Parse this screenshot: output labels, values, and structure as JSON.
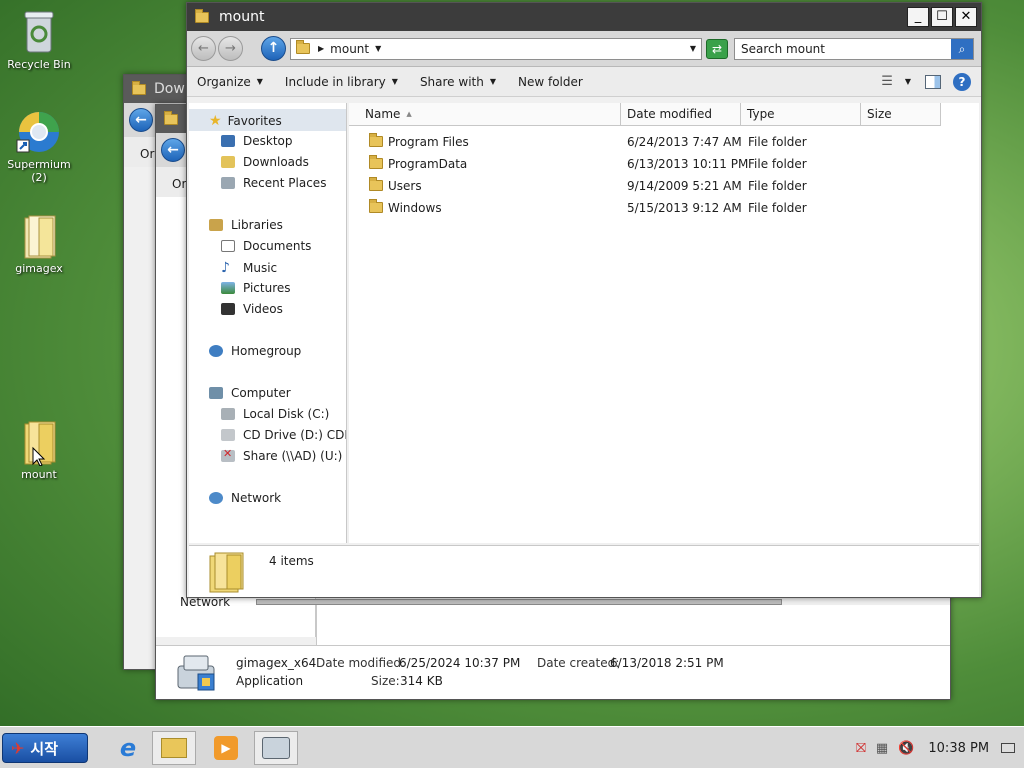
{
  "desktop": {
    "icons": [
      {
        "label": "Recycle Bin"
      },
      {
        "label": "Supermium\n(2)"
      },
      {
        "label": "gimagex"
      },
      {
        "label": "mount"
      }
    ]
  },
  "bg_window_1": {
    "title": "Dow",
    "nav_frag": "Or"
  },
  "bg_window_2": {
    "title": "gimagex_x64",
    "nav_frag": "Or",
    "nav_network": "Network",
    "details": {
      "name": "gimagex_x64",
      "type": "Application",
      "date_modified_label": "Date modified:",
      "date_modified": "6/25/2024 10:37 PM",
      "date_created_label": "Date created:",
      "date_created": "6/13/2018 2:51 PM",
      "size_label": "Size:",
      "size": "314 KB"
    }
  },
  "main_window": {
    "title": "mount",
    "caption_buttons": {
      "minimize": "_",
      "maximize": "☐",
      "close": "✕"
    },
    "address": {
      "path": "mount",
      "search_placeholder": "Search mount"
    },
    "toolbar": {
      "organize": "Organize",
      "include": "Include in library",
      "share": "Share with",
      "new_folder": "New folder"
    },
    "nav": {
      "favorites": "Favorites",
      "desktop": "Desktop",
      "downloads": "Downloads",
      "recent": "Recent Places",
      "libraries": "Libraries",
      "documents": "Documents",
      "music": "Music",
      "pictures": "Pictures",
      "videos": "Videos",
      "homegroup": "Homegroup",
      "computer": "Computer",
      "local_disk": "Local Disk (C:)",
      "cd_drive": "CD Drive (D:) CDROM",
      "share": "Share (\\\\AD) (U:)",
      "network": "Network"
    },
    "columns": {
      "name": "Name",
      "date": "Date modified",
      "type": "Type",
      "size": "Size"
    },
    "files": [
      {
        "name": "Program Files",
        "date": "6/24/2013 7:47 AM",
        "type": "File folder"
      },
      {
        "name": "ProgramData",
        "date": "6/13/2013 10:11 PM",
        "type": "File folder"
      },
      {
        "name": "Users",
        "date": "9/14/2009 5:21 AM",
        "type": "File folder"
      },
      {
        "name": "Windows",
        "date": "5/15/2013 9:12 AM",
        "type": "File folder"
      }
    ],
    "status": "4 items"
  },
  "taskbar": {
    "start_label": "시작",
    "clock": "10:38 PM"
  }
}
